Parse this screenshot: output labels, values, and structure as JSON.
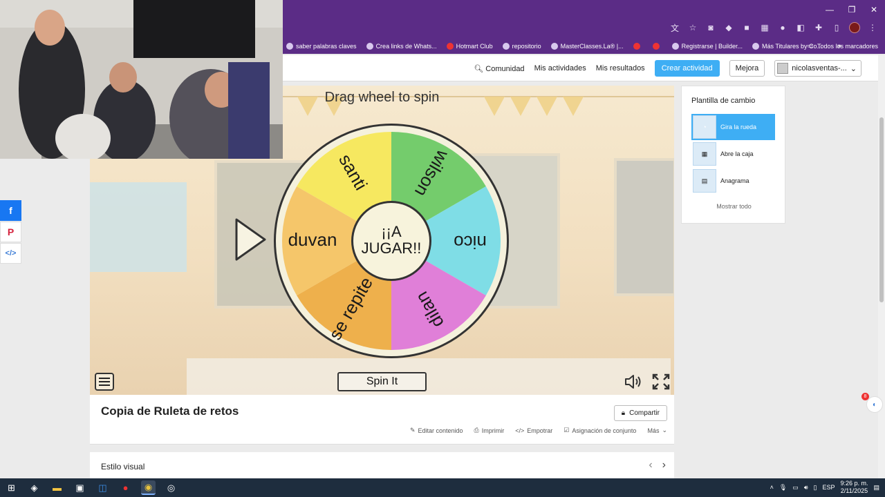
{
  "browser": {
    "bookmarks": [
      {
        "label": "saber palabras claves"
      },
      {
        "label": "Crea links de Whats..."
      },
      {
        "label": "Hotmart Club"
      },
      {
        "label": "repositorio"
      },
      {
        "label": "MasterClasses.La® |..."
      },
      {
        "label": ""
      },
      {
        "label": ""
      },
      {
        "label": "Registrarse | Builder..."
      },
      {
        "label": "Más Titulares by Co..."
      }
    ],
    "more_label": "»",
    "all_bookmarks_label": "Todos los marcadores"
  },
  "nav": {
    "comunidad": "Comunidad",
    "mis_actividades": "Mis actividades",
    "mis_resultados": "Mis resultados",
    "crear_actividad": "Crear actividad",
    "mejora": "Mejora",
    "user": "nicolasventas-..."
  },
  "game": {
    "instruction": "Drag wheel to spin",
    "center_label_1": "¡¡A",
    "center_label_2": "JUGAR!!",
    "spin_label": "Spin It",
    "segments": [
      {
        "label": "wilson",
        "color": "#74cc6c"
      },
      {
        "label": "nico",
        "color": "#7fdde6"
      },
      {
        "label": "dilan",
        "color": "#e07fd8"
      },
      {
        "label": "se repite",
        "color": "#eeb04c"
      },
      {
        "label": "duvan",
        "color": "#f5c66a"
      },
      {
        "label": "santi",
        "color": "#f6e860"
      }
    ]
  },
  "template_panel": {
    "title": "Plantilla de cambio",
    "items": [
      {
        "label": "Gira la rueda",
        "active": true
      },
      {
        "label": "Abre la caja",
        "active": false
      },
      {
        "label": "Anagrama",
        "active": false
      }
    ],
    "show_all": "Mostrar todo"
  },
  "activity": {
    "title": "Copia de Ruleta de retos",
    "share": "Compartir",
    "actions": {
      "edit": "Editar contenido",
      "print": "Imprimir",
      "embed": "Empotrar",
      "assign": "Asignación de conjunto",
      "more": "Más"
    }
  },
  "visual_style": {
    "title": "Estilo visual"
  },
  "notifications": {
    "badge_count": "8"
  },
  "taskbar": {
    "lang": "ESP",
    "time": "9:26 p. m.",
    "date": "2/11/2025"
  },
  "colors": {
    "browser_purple": "#5b2c86",
    "accent_blue": "#3eaef4"
  }
}
